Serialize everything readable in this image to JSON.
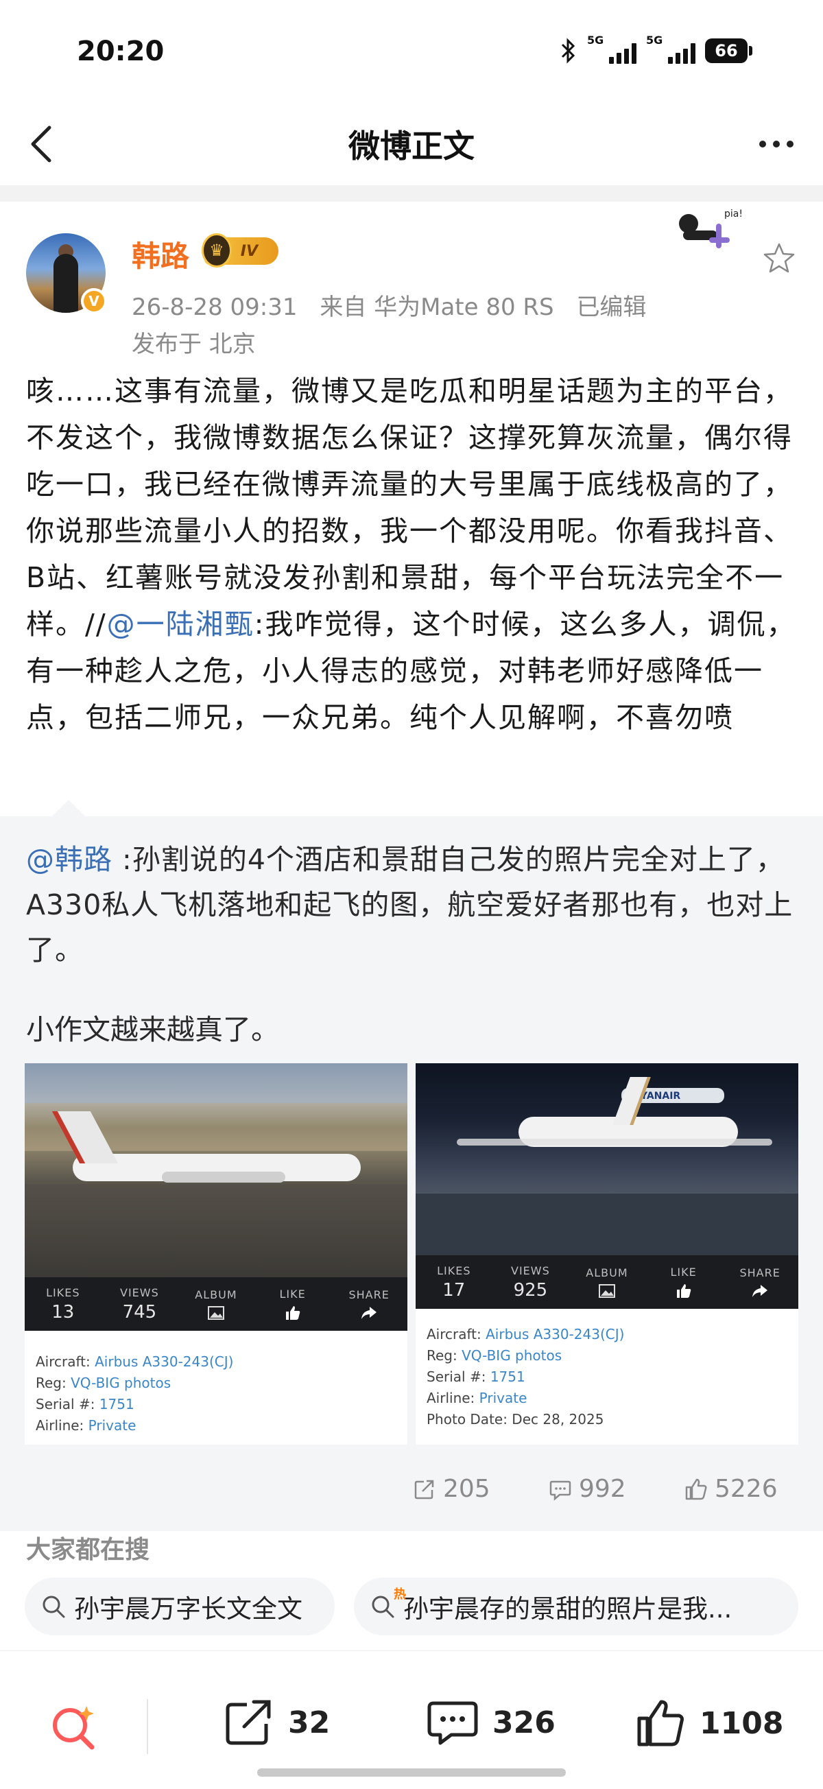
{
  "status_bar": {
    "time": "20:20",
    "network1": "5G",
    "network2": "5G",
    "battery": "66",
    "icons": [
      "bluetooth-icon",
      "signal-icon",
      "battery-icon"
    ]
  },
  "nav": {
    "title": "微博正文",
    "back_icon": "chevron-left-icon",
    "more_icon": "more-dots-icon"
  },
  "author": {
    "name": "韩路",
    "badge": "IV",
    "timestamp": "26-8-28 09:31",
    "source": "来自 华为Mate 80 RS",
    "edited": "已编辑",
    "location": "发布于 北京"
  },
  "post": {
    "text_before": "咳……这事有流量，微博又是吃瓜和明星话题为主的平台，不发这个，我微博数据怎么保证？这撑死算灰流量，偶尔得吃一口，我已经在微博弄流量的大号里属于底线极高的了，你说那些流量小人的招数，我一个都没用呢。你看我抖音、B站、红薯账号就没发孙割和景甜，每个平台玩法完全不一样。//",
    "mention": "@一陆湘甄",
    "text_after": ":我咋觉得，这个时候，这么多人，调侃，有一种趁人之危，小人得志的感觉，对韩老师好感降低一点，包括二师兄，一众兄弟。纯个人见解啊，不喜勿喷"
  },
  "retweet": {
    "mention": "@韩路",
    "text": " :孙割说的4个酒店和景甜自己发的照片完全对上了，A330私人飞机落地和起飞的图，航空爱好者那也有，也对上了。",
    "text2": "小作文越来越真了。",
    "photos": [
      {
        "stats": [
          {
            "key": "LIKES",
            "value": "13"
          },
          {
            "key": "VIEWS",
            "value": "745"
          },
          {
            "key": "ALBUM",
            "icon": "album-icon"
          },
          {
            "key": "LIKE",
            "icon": "thumbs-up-icon"
          },
          {
            "key": "SHARE",
            "icon": "share-arrow-icon"
          }
        ],
        "aircraft_label": "Aircraft: ",
        "aircraft": "Airbus A330-243(CJ)",
        "reg_label": "Reg: ",
        "reg": "VQ-BIG photos",
        "serial_label": "Serial #: ",
        "serial": "1751",
        "airline_label": "Airline: ",
        "airline": "Private"
      },
      {
        "stats": [
          {
            "key": "LIKES",
            "value": "17"
          },
          {
            "key": "VIEWS",
            "value": "925"
          },
          {
            "key": "ALBUM",
            "icon": "album-icon"
          },
          {
            "key": "LIKE",
            "icon": "thumbs-up-icon"
          },
          {
            "key": "SHARE",
            "icon": "share-arrow-icon"
          }
        ],
        "aircraft_label": "Aircraft: ",
        "aircraft": "Airbus A330-243(CJ)",
        "reg_label": "Reg: ",
        "reg": "VQ-BIG photos",
        "serial_label": "Serial #: ",
        "serial": "1751",
        "airline_label": "Airline: ",
        "airline": "Private",
        "photo_date": "Photo Date: Dec 28, 2025",
        "banner": "RYANAIR"
      }
    ],
    "actions": {
      "reposts": "205",
      "comments": "992",
      "likes": "5226"
    }
  },
  "trending": {
    "title": "大家都在搜",
    "items": [
      {
        "label": "孙宇晨万字长文全文",
        "icon": "search-icon"
      },
      {
        "label": "孙宇晨存的景甜的照片是我...",
        "icon": "search-icon",
        "tag": "热"
      }
    ]
  },
  "bottom_bar": {
    "reposts": "32",
    "comments": "326",
    "likes": "1108"
  },
  "colors": {
    "accent_orange": "#f36f20",
    "mention_blue": "#3a6fb5",
    "muted_gray": "#8a8a8a",
    "retweet_bg": "#f4f5f7"
  }
}
